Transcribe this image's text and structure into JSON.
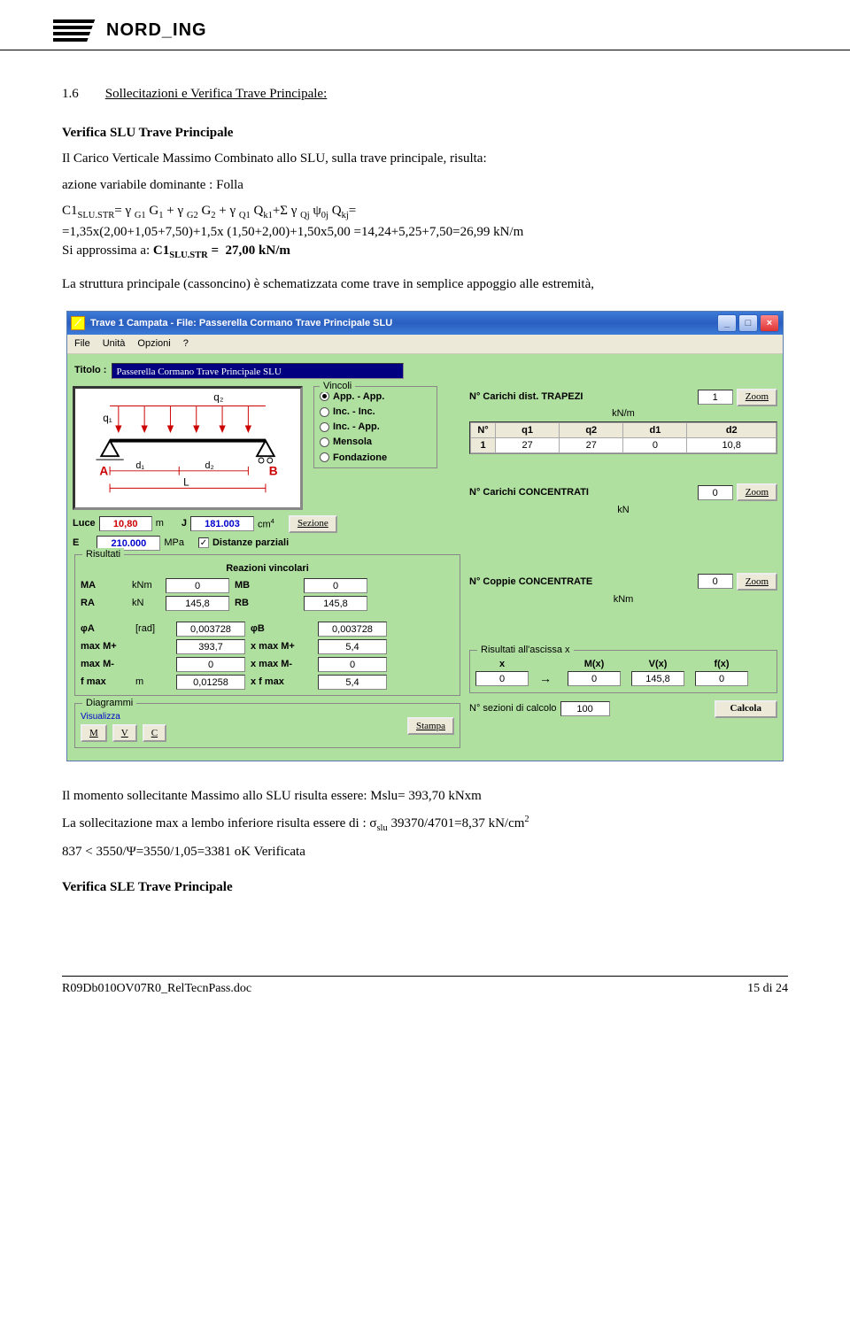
{
  "header": {
    "logo_text": "NORD_ING"
  },
  "doc": {
    "section_num": "1.6",
    "section_label": "Sollecitazioni e Verifica Trave Principale:",
    "h_verifica_slu": "Verifica SLU Trave Principale",
    "p1": "Il Carico Verticale Massimo Combinato allo SLU, sulla trave principale, risulta:",
    "p2": "azione variabile dominante : Folla",
    "f1": "C1SLU.STR= γ G1 G1 + γ G2 G2 + γ Q1 Qk1+Σ γ Qj ψ0j Qkj=",
    "f2": "=1,35x(2,00+1,05+7,50)+1,5x (1,50+2,00)+1,50x5,00 =14,24+5,25+7,50=26,99 kN/m",
    "f3a": "Si approssima a:  ",
    "f3b": "C1SLU.STR =  27,00 kN/m",
    "p3": "La struttura principale (cassoncino) è schematizzata come trave in semplice appoggio alle estremità,",
    "p_mslu": "Il momento sollecitante Massimo allo SLU risulta essere: Mslu= 393,70 kNxm",
    "p_sigma_a": "La sollecitazione max a lembo inferiore risulta essere di : σ",
    "p_sigma_sub": "slu",
    "p_sigma_b": " 39370/4701=8,37 kN/cm",
    "p_sigma_sup": "2",
    "p_ver": "837 < 3550/Ψ=3550/1,05=3381 oK Verificata",
    "h_verifica_sle": "Verifica SLE  Trave Principale"
  },
  "window": {
    "title": "Trave 1 Campata - File: Passerella Cormano Trave Principale SLU",
    "menus": [
      "File",
      "Unità",
      "Opzioni",
      "?"
    ],
    "titolo_label": "Titolo :",
    "titolo_value": "Passerella Cormano Trave Principale SLU",
    "vincoli": {
      "legend": "Vincoli",
      "options": [
        "App. - App.",
        "Inc. - Inc.",
        "Inc. - App.",
        "Mensola",
        "Fondazione"
      ],
      "selected": 0
    },
    "luce_label": "Luce",
    "luce_value": "10,80",
    "luce_unit": "m",
    "j_label": "J",
    "j_value": "181.003",
    "j_unit": "cm",
    "j_exp": "4",
    "sezione_btn": "Sezione",
    "e_label": "E",
    "e_value": "210.000",
    "e_unit": "MPa",
    "dist_parz_label": "Distanze parziali",
    "dist_parz_checked": true,
    "risultati": {
      "legend": "Risultati",
      "reazioni_label": "Reazioni vincolari",
      "rows": [
        {
          "l1": "MA",
          "u": "kNm",
          "v1": "0",
          "l2": "MB",
          "v2": "0"
        },
        {
          "l1": "RA",
          "u": "kN",
          "v1": "145,8",
          "l2": "RB",
          "v2": "145,8"
        }
      ],
      "rows2": [
        {
          "l1": "φA",
          "u": "[rad]",
          "v1": "0,003728",
          "l2": "φB",
          "v2": "0,003728"
        },
        {
          "l1": "max M+",
          "u": "",
          "v1": "393,7",
          "l2": "x max M+",
          "v2": "5,4"
        },
        {
          "l1": "max M-",
          "u": "",
          "v1": "0",
          "l2": "x max M-",
          "v2": "0"
        },
        {
          "l1": "f max",
          "u": "m",
          "v1": "0,01258",
          "l2": "x f max",
          "v2": "5,4"
        }
      ]
    },
    "diagrammi": {
      "legend": "Diagrammi",
      "visualizza": "Visualizza",
      "m": "M",
      "v": "V",
      "c": "C",
      "stampa": "Stampa"
    },
    "trapezi": {
      "label": "N° Carichi dist. TRAPEZI",
      "unit": "kN/m",
      "count": "1",
      "zoom": "Zoom",
      "headers": [
        "N°",
        "q1",
        "q2",
        "d1",
        "d2"
      ],
      "row": [
        "1",
        "27",
        "27",
        "0",
        "10,8"
      ]
    },
    "concentrati": {
      "label": "N° Carichi CONCENTRATI",
      "unit": "kN",
      "count": "0",
      "zoom": "Zoom"
    },
    "coppie": {
      "label": "N° Coppie CONCENTRATE",
      "unit": "kNm",
      "count": "0",
      "zoom": "Zoom"
    },
    "risx": {
      "legend": "Risultati all'ascissa x",
      "heads": [
        "x",
        "",
        "M(x)",
        "V(x)",
        "f(x)"
      ],
      "vals": [
        "0",
        "→",
        "0",
        "145,8",
        "0"
      ]
    },
    "sezcalc_label": "N° sezioni di calcolo",
    "sezcalc_val": "100",
    "calcola_btn": "Calcola"
  },
  "footer": {
    "left": "R09Db010OV07R0_RelTecnPass.doc",
    "right": "15 di 24"
  }
}
